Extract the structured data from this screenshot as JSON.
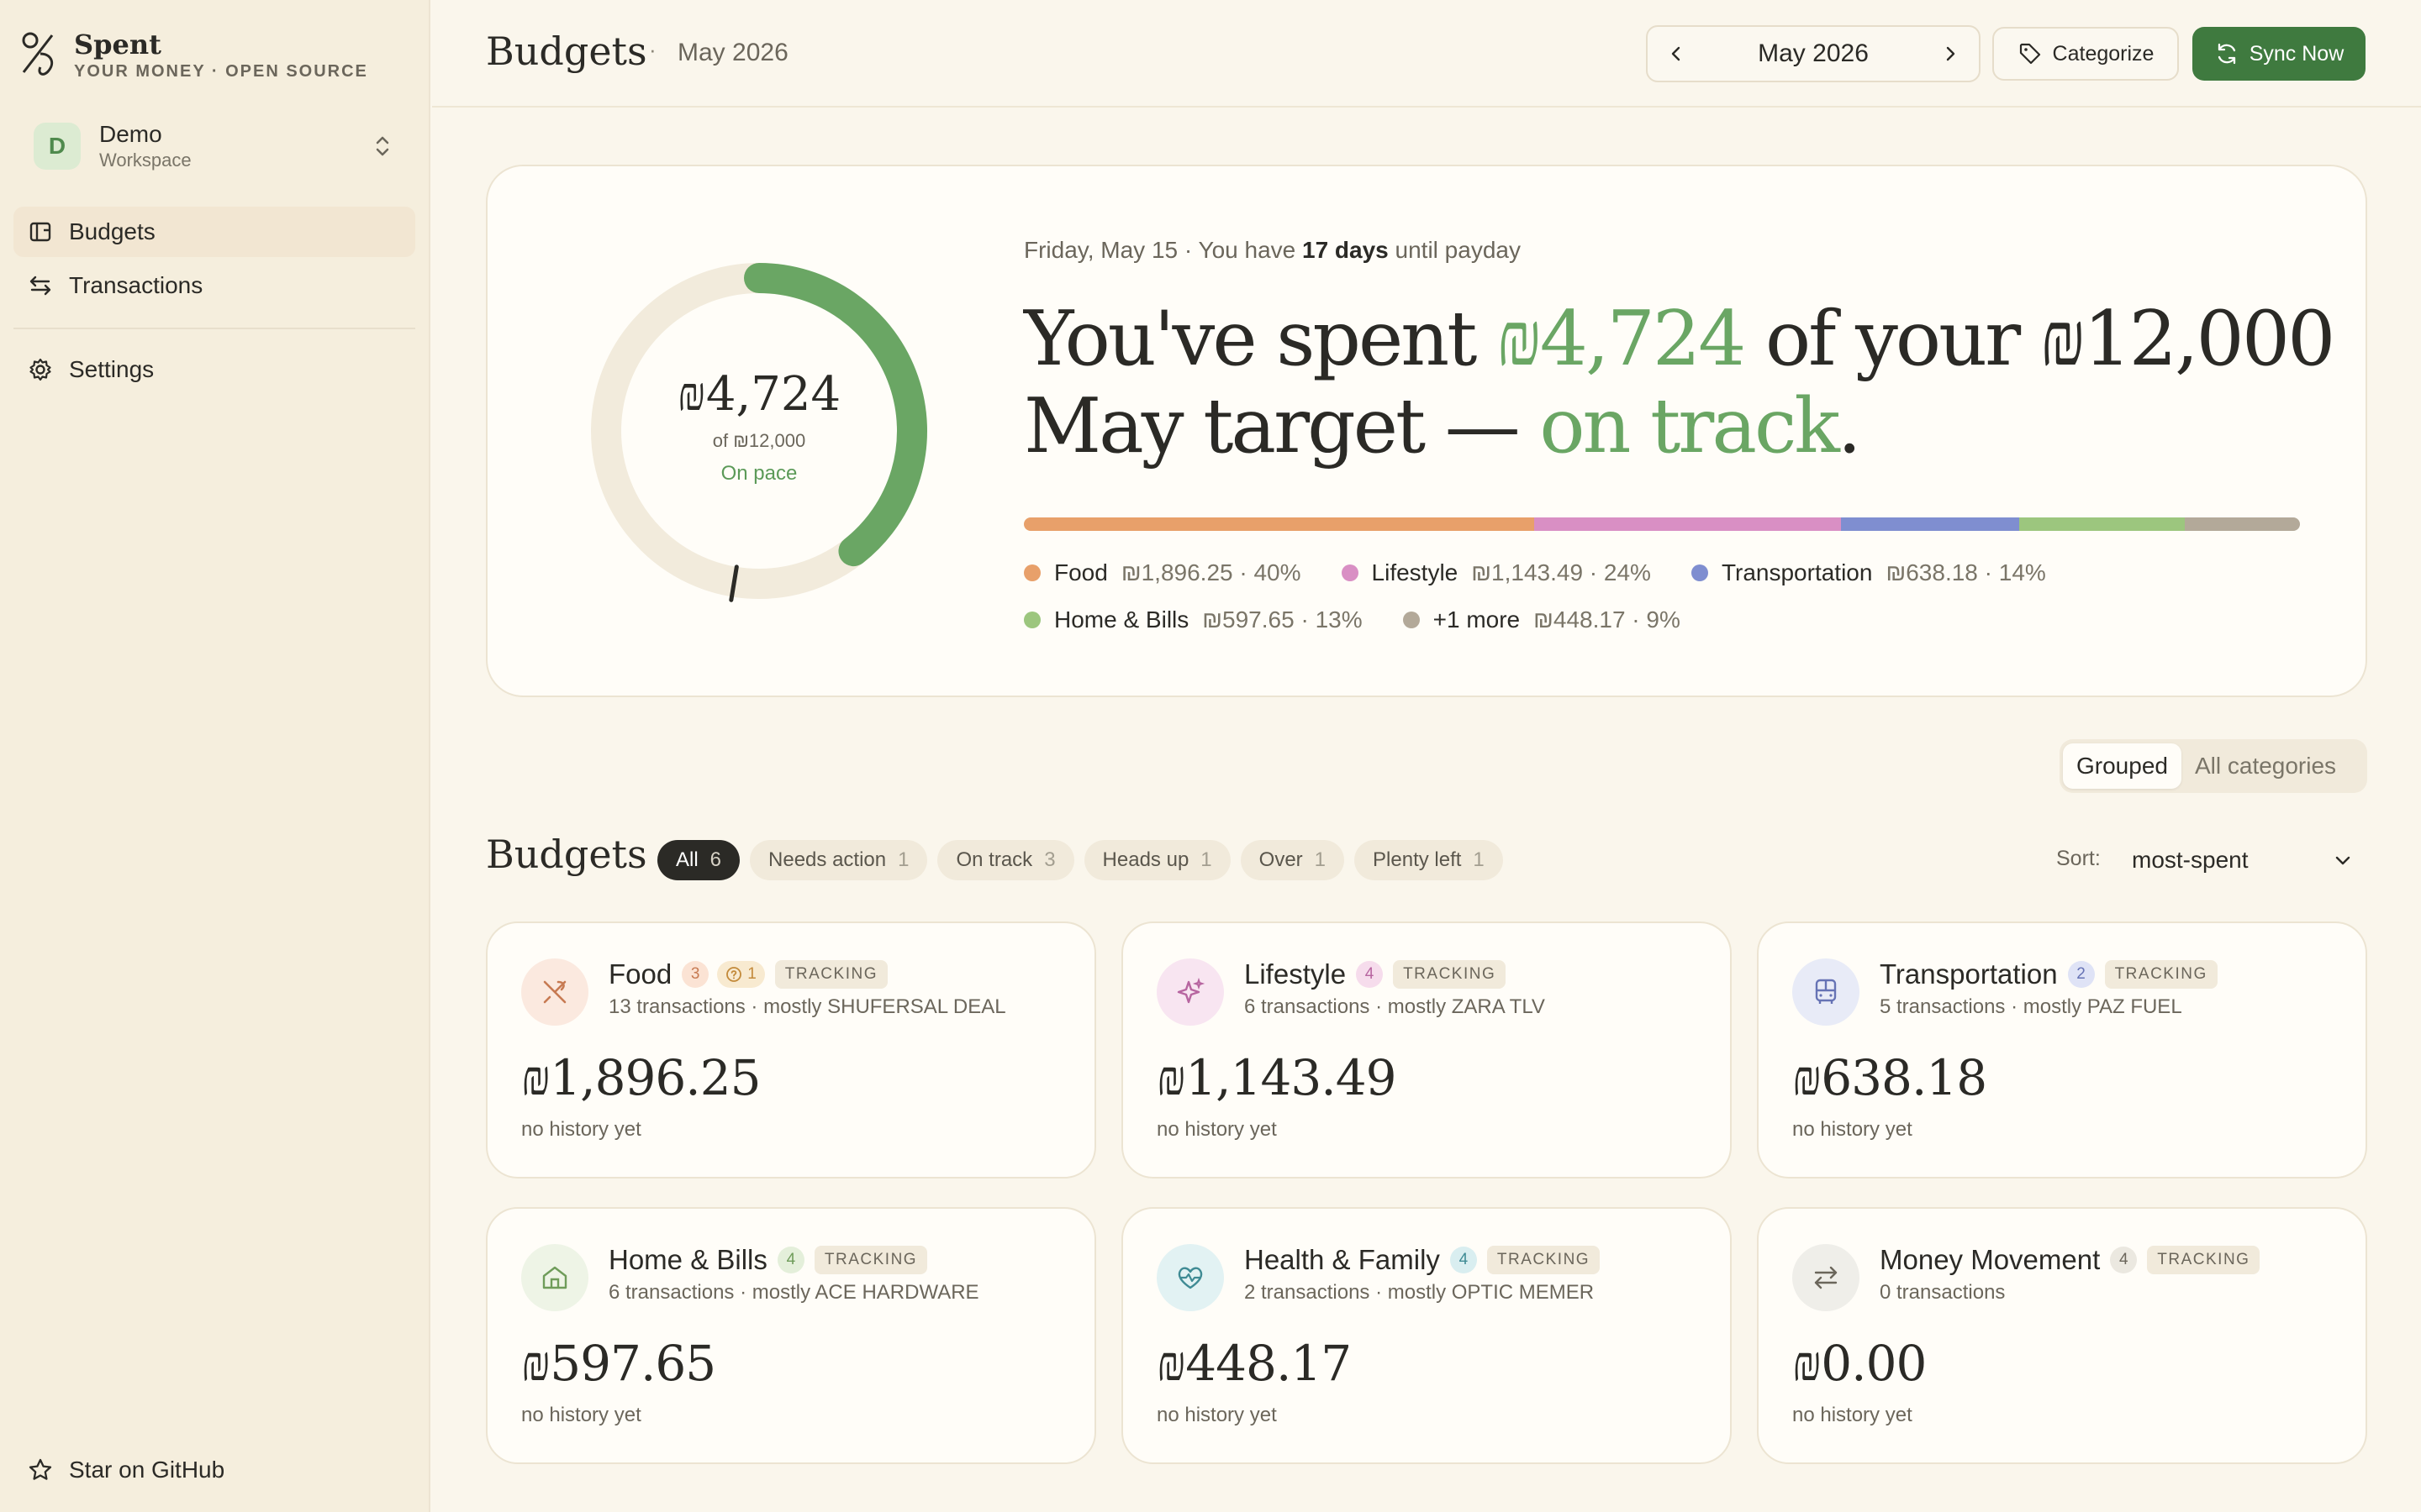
{
  "sidebar": {
    "brand_name": "Spent",
    "brand_tag": "YOUR MONEY · OPEN SOURCE",
    "workspace_initial": "D",
    "workspace_name": "Demo",
    "workspace_sub": "Workspace",
    "nav": [
      "Budgets",
      "Transactions"
    ],
    "settings": "Settings",
    "star": "Star on GitHub"
  },
  "header": {
    "title": "Budgets",
    "dot": "·",
    "month": "May 2026",
    "picker_label": "May 2026",
    "categorize": "Categorize",
    "sync": "Sync Now"
  },
  "hero": {
    "date_prefix": "Friday, May 15 · You have ",
    "days": "17 days",
    "date_suffix": " until payday",
    "head_1": "You've spent ",
    "spent": "₪4,724",
    "head_2": " of your ₪12,000 May target — ",
    "status": "on track",
    "head_3": ".",
    "donut_amount": "₪4,724",
    "donut_of": "of ₪12,000",
    "donut_pace": "On pace",
    "spent_fraction": 0.394,
    "pace_fraction": 0.526,
    "legend": [
      {
        "name": "Food",
        "value": "₪1,896.25 · 40%",
        "color": "#e8a06a",
        "share": 40
      },
      {
        "name": "Lifestyle",
        "value": "₪1,143.49 · 24%",
        "color": "#d98fc4",
        "share": 24
      },
      {
        "name": "Transportation",
        "value": "₪638.18 · 14%",
        "color": "#7f8ed0",
        "share": 14
      },
      {
        "name": "Home & Bills",
        "value": "₪597.65 · 13%",
        "color": "#9cc67e",
        "share": 13
      },
      {
        "name": "+1 more",
        "value": "₪448.17 · 9%",
        "color": "#b3a999",
        "share": 9
      }
    ]
  },
  "view_toggle": [
    "Grouped",
    "All categories"
  ],
  "budgets": {
    "title": "Budgets",
    "chips": [
      {
        "label": "All",
        "count": "6"
      },
      {
        "label": "Needs action",
        "count": "1"
      },
      {
        "label": "On track",
        "count": "3"
      },
      {
        "label": "Heads up",
        "count": "1"
      },
      {
        "label": "Over",
        "count": "1"
      },
      {
        "label": "Plenty left",
        "count": "1"
      }
    ],
    "sort_label": "Sort:",
    "sort_value": "most-spent",
    "cards": [
      {
        "name": "Food",
        "badge": "3",
        "question": "1",
        "tag": "TRACKING",
        "sub": "13 transactions · mostly SHUFERSAL DEAL",
        "amount": "₪1,896.25",
        "history": "no history yet",
        "icon": "utensils-icon",
        "icon_bg": "#fbe9df",
        "icon_color": "#c77a52",
        "badge_bg": "#fbe3d4",
        "badge_color": "#c77a52"
      },
      {
        "name": "Lifestyle",
        "badge": "4",
        "question": "",
        "tag": "TRACKING",
        "sub": "6 transactions · mostly ZARA TLV",
        "amount": "₪1,143.49",
        "history": "no history yet",
        "icon": "sparkles-icon",
        "icon_bg": "#f8e5f1",
        "icon_color": "#b765a0",
        "badge_bg": "#f6dcec",
        "badge_color": "#b765a0"
      },
      {
        "name": "Transportation",
        "badge": "2",
        "question": "",
        "tag": "TRACKING",
        "sub": "5 transactions · mostly PAZ FUEL",
        "amount": "₪638.18",
        "history": "no history yet",
        "icon": "bus-icon",
        "icon_bg": "#e8ebf7",
        "icon_color": "#6673b5",
        "badge_bg": "#dfe3f6",
        "badge_color": "#6673b5"
      },
      {
        "name": "Home & Bills",
        "badge": "4",
        "question": "",
        "tag": "TRACKING",
        "sub": "6 transactions · mostly ACE HARDWARE",
        "amount": "₪597.65",
        "history": "no history yet",
        "icon": "home-icon",
        "icon_bg": "#eef4e6",
        "icon_color": "#6f9c5a",
        "badge_bg": "#e4efda",
        "badge_color": "#6f9c5a"
      },
      {
        "name": "Health & Family",
        "badge": "4",
        "question": "",
        "tag": "TRACKING",
        "sub": "2 transactions · mostly OPTIC MEMER",
        "amount": "₪448.17",
        "history": "no history yet",
        "icon": "heart-pulse-icon",
        "icon_bg": "#e2f2f3",
        "icon_color": "#3f8b94",
        "badge_bg": "#d9eef0",
        "badge_color": "#3f8b94"
      },
      {
        "name": "Money Movement",
        "badge": "4",
        "question": "",
        "tag": "TRACKING",
        "sub": "0 transactions",
        "amount": "₪0.00",
        "history": "no history yet",
        "icon": "transfer-icon",
        "icon_bg": "#efeee9",
        "icon_color": "#6b665b",
        "badge_bg": "#ebe8e0",
        "badge_color": "#6b665b"
      }
    ]
  }
}
